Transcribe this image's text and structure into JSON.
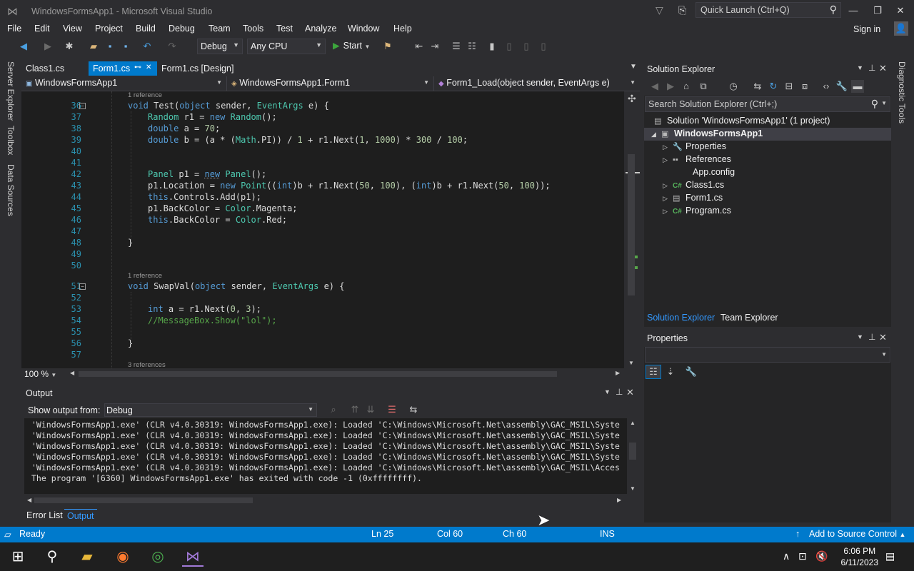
{
  "window": {
    "title": "WindowsFormsApp1 - Microsoft Visual Studio",
    "quick_launch_placeholder": "Quick Launch (Ctrl+Q)",
    "sign_in": "Sign in"
  },
  "menu": [
    "File",
    "Edit",
    "View",
    "Project",
    "Build",
    "Debug",
    "Team",
    "Tools",
    "Test",
    "Analyze",
    "Window",
    "Help"
  ],
  "toolbar": {
    "config": "Debug",
    "platform": "Any CPU",
    "start": "Start"
  },
  "left_tabs": [
    "Server Explorer",
    "Toolbox",
    "Data Sources"
  ],
  "doc_tabs": [
    {
      "label": "Class1.cs"
    },
    {
      "label": "Form1.cs",
      "pin": "⊷",
      "close": "✕"
    },
    {
      "label": "Form1.cs [Design]"
    }
  ],
  "nav": {
    "project": "WindowsFormsApp1",
    "type": "WindowsFormsApp1.Form1",
    "member": "Form1_Load(object sender, EventArgs e)"
  },
  "editor": {
    "zoom": "100 %",
    "ref_hints": [
      "1 reference",
      "1 reference",
      "3 references"
    ],
    "line_numbers": [
      "36",
      "37",
      "38",
      "39",
      "40",
      "41",
      "42",
      "43",
      "44",
      "45",
      "46",
      "47",
      "48",
      "49",
      "50",
      "51",
      "52",
      "53",
      "54",
      "55",
      "56",
      "57"
    ]
  },
  "output": {
    "title": "Output",
    "show_from_label": "Show output from:",
    "source": "Debug",
    "lines": [
      "'WindowsFormsApp1.exe' (CLR v4.0.30319: WindowsFormsApp1.exe): Loaded 'C:\\Windows\\Microsoft.Net\\assembly\\GAC_MSIL\\Syste",
      "'WindowsFormsApp1.exe' (CLR v4.0.30319: WindowsFormsApp1.exe): Loaded 'C:\\Windows\\Microsoft.Net\\assembly\\GAC_MSIL\\Syste",
      "'WindowsFormsApp1.exe' (CLR v4.0.30319: WindowsFormsApp1.exe): Loaded 'C:\\Windows\\Microsoft.Net\\assembly\\GAC_MSIL\\Syste",
      "'WindowsFormsApp1.exe' (CLR v4.0.30319: WindowsFormsApp1.exe): Loaded 'C:\\Windows\\Microsoft.Net\\assembly\\GAC_MSIL\\Syste",
      "'WindowsFormsApp1.exe' (CLR v4.0.30319: WindowsFormsApp1.exe): Loaded 'C:\\Windows\\Microsoft.Net\\assembly\\GAC_MSIL\\Acces",
      "The program '[6360] WindowsFormsApp1.exe' has exited with code -1 (0xffffffff)."
    ],
    "bottom_tabs": [
      "Error List",
      "Output"
    ]
  },
  "solution_explorer": {
    "title": "Solution Explorer",
    "search_placeholder": "Search Solution Explorer (Ctrl+;)",
    "solution": "Solution 'WindowsFormsApp1' (1 project)",
    "project": "WindowsFormsApp1",
    "items": [
      "Properties",
      "References",
      "App.config",
      "Class1.cs",
      "Form1.cs",
      "Program.cs"
    ],
    "tabs": [
      "Solution Explorer",
      "Team Explorer"
    ]
  },
  "properties": {
    "title": "Properties"
  },
  "right_tabs": [
    "Diagnostic Tools"
  ],
  "status": {
    "state": "Ready",
    "line": "Ln 25",
    "col": "Col 60",
    "ch": "Ch 60",
    "mode": "INS",
    "source_control": "Add to Source Control"
  },
  "taskbar": {
    "time": "6:06 PM",
    "date": "6/11/2023"
  },
  "colors": {
    "accent": "#007acc",
    "editor_bg": "#1e1e1e",
    "keyword": "#569cd6",
    "type": "#4ec9b0",
    "string": "#d69d85",
    "comment": "#57a64a"
  }
}
